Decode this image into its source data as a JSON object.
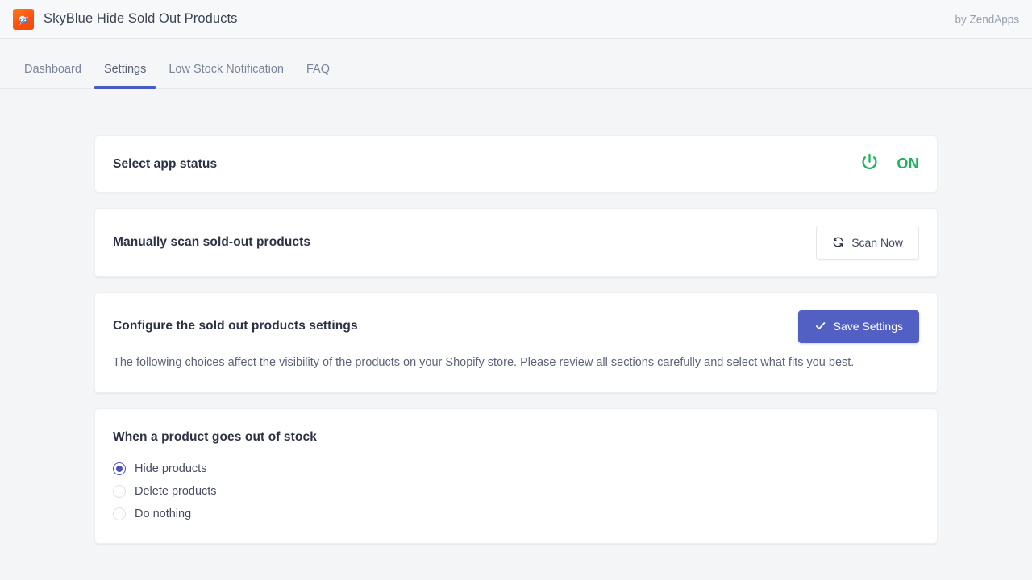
{
  "header": {
    "title": "SkyBlue Hide Sold Out Products",
    "vendor": "by ZendApps",
    "logo_icon": "hidden-eye-cloud-icon"
  },
  "tabs": [
    {
      "label": "Dashboard",
      "active": false
    },
    {
      "label": "Settings",
      "active": true
    },
    {
      "label": "Low Stock Notification",
      "active": false
    },
    {
      "label": "FAQ",
      "active": false
    }
  ],
  "cards": {
    "status": {
      "title": "Select app status",
      "toggle_icon": "power-icon",
      "toggle_label": "ON",
      "toggle_color": "#1cb55c"
    },
    "scan": {
      "title": "Manually scan sold-out products",
      "button_label": "Scan Now",
      "button_icon": "refresh-icon"
    },
    "configure": {
      "title": "Configure the sold out products settings",
      "button_label": "Save Settings",
      "button_icon": "check-icon",
      "button_color": "#5260c4",
      "description": "The following choices affect the visibility of the products on your Shopify store. Please review all sections carefully and select what fits you best."
    },
    "out_of_stock": {
      "title": "When a product goes out of stock",
      "options": [
        {
          "label": "Hide products",
          "selected": true
        },
        {
          "label": "Delete products",
          "selected": false
        },
        {
          "label": "Do nothing",
          "selected": false
        }
      ],
      "accent_color": "#4a54b8"
    }
  }
}
